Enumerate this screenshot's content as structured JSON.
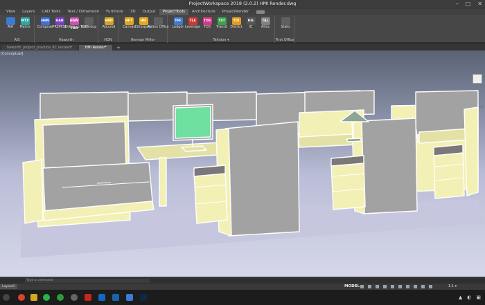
{
  "window": {
    "title": "ProjectWorkspace 2018 (2.0.2)    HMI Render.dwg",
    "controls": [
      "–",
      "□",
      "✕"
    ]
  },
  "ribbon_tabs": [
    {
      "label": "View",
      "active": false
    },
    {
      "label": "Layers",
      "active": false
    },
    {
      "label": "CAD Tools",
      "active": false
    },
    {
      "label": "Text / Dimension",
      "active": false
    },
    {
      "label": "Furniture",
      "active": false
    },
    {
      "label": "3D",
      "active": false
    },
    {
      "label": "Output",
      "active": false
    },
    {
      "label": "ProjectTools",
      "active": true
    },
    {
      "label": "Architecture",
      "active": false
    },
    {
      "label": "ProjectRender",
      "active": false
    }
  ],
  "ribbon_groups": [
    {
      "label": "AIS",
      "buttons": [
        {
          "code": "",
          "label": "AIA",
          "color": "#3a7bd5"
        },
        {
          "code": "MTX",
          "label": "Matrix",
          "color": "#2aa7a0"
        }
      ]
    },
    {
      "label": "Haworth",
      "buttons": [
        {
          "code": "HHN",
          "label": "Compose",
          "color": "#3c6fd8"
        },
        {
          "code": "HAN",
          "label": "PREMISE",
          "color": "#7a3fc8"
        },
        {
          "code": "HAW TOO",
          "label": "UniGroup TOO",
          "color": "#d14fb3"
        },
        {
          "code": "",
          "label": "UniGroup",
          "color": "#5f5f5f"
        }
      ]
    },
    {
      "label": "HON",
      "buttons": [
        {
          "code": "HND",
          "label": "Abound",
          "color": "#d4a21c"
        }
      ]
    },
    {
      "label": "Herman Miller",
      "buttons": [
        {
          "code": "HFT",
          "label": "Canvas",
          "color": "#e0a41a"
        },
        {
          "code": "HEI",
          "label": "Ethospace",
          "color": "#e8a81b"
        },
        {
          "code": "",
          "label": "Action Office",
          "color": "#5f5f5f"
        }
      ]
    },
    {
      "label": "Teknion ▾",
      "buttons": [
        {
          "code": "TFF",
          "label": "Ledger",
          "color": "#3d7ad0"
        },
        {
          "code": "TLE",
          "label": "Leverage",
          "color": "#d33535"
        },
        {
          "code": "TOS",
          "label": "TOS",
          "color": "#d8358a"
        },
        {
          "code": "TST",
          "label": "Transit",
          "color": "#3aa34a"
        },
        {
          "code": "TDI",
          "label": "District",
          "color": "#e49a18"
        },
        {
          "code": "RIE",
          "label": "iE",
          "color": "#555555"
        },
        {
          "code": "TAL",
          "label": "Altos",
          "color": "#808080"
        }
      ]
    },
    {
      "label": "First Office",
      "buttons": [
        {
          "code": "",
          "label": "Staks",
          "color": "#5f5f5f"
        }
      ]
    }
  ],
  "doc_tabs": [
    {
      "label": "haworth_project_practice_KC.revised*",
      "active": false
    },
    {
      "label": "HMI Render*",
      "active": true
    }
  ],
  "viewport": {
    "label": "[Conceptual]",
    "wcs": "WCS"
  },
  "command": {
    "placeholder": "Type a command"
  },
  "status": {
    "layout_tab": "Layout1",
    "model": "MODEL",
    "scale": "1:1 ▾"
  },
  "colors": {
    "panel_fill": "#f2f0b4",
    "panel_fabric": "#a3a2a3",
    "worksurface": "#e3e1a6",
    "monitor_screen": "#6fe0a0"
  }
}
